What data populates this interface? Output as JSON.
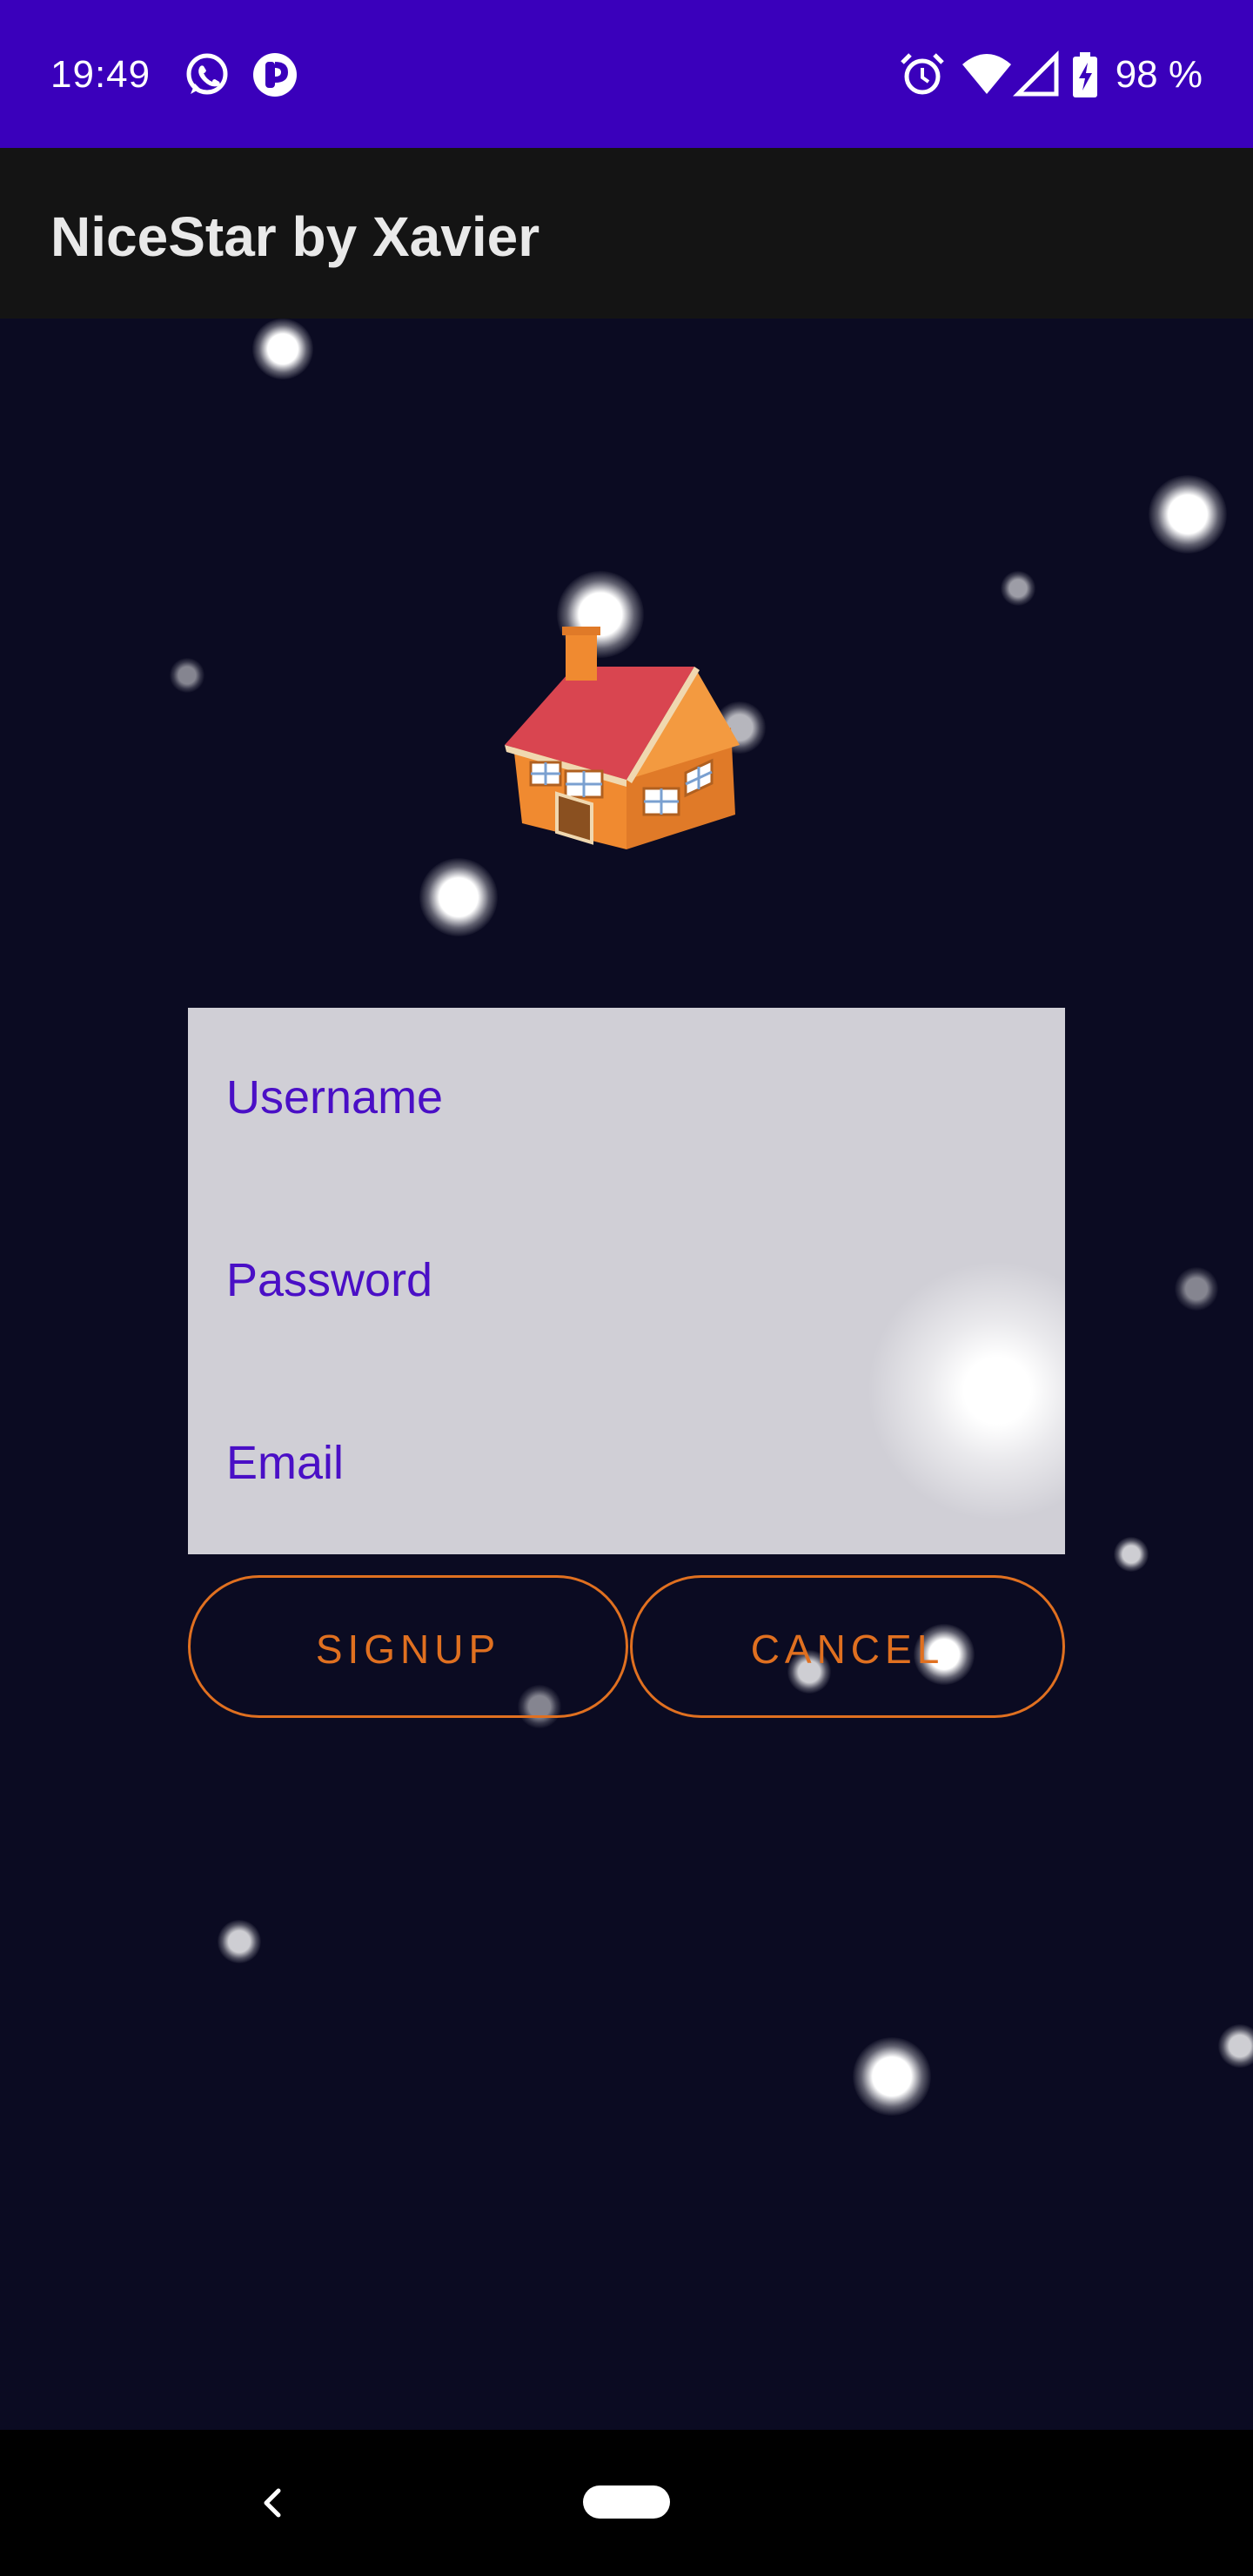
{
  "status_bar": {
    "time": "19:49",
    "battery": "98 %",
    "left_icons": [
      "whatsapp-icon",
      "notification-app-icon"
    ],
    "right_icons": [
      "alarm-icon",
      "wifi-icon",
      "signal-icon",
      "battery-charging-icon"
    ]
  },
  "app_bar": {
    "title": "NiceStar by Xavier"
  },
  "form": {
    "username_placeholder": "Username",
    "password_placeholder": "Password",
    "email_placeholder": "Email"
  },
  "buttons": {
    "signup": "SIGNUP",
    "cancel": "CANCEL"
  },
  "colors": {
    "status_bar": "#3a00bb",
    "app_bar": "#141414",
    "background": "#0b0b22",
    "field_text": "#4a0fc6",
    "button_accent": "#e07020",
    "form_panel": "#d0cfd6"
  },
  "nav_bar": {
    "icons": [
      "back-icon",
      "home-pill-icon"
    ]
  }
}
